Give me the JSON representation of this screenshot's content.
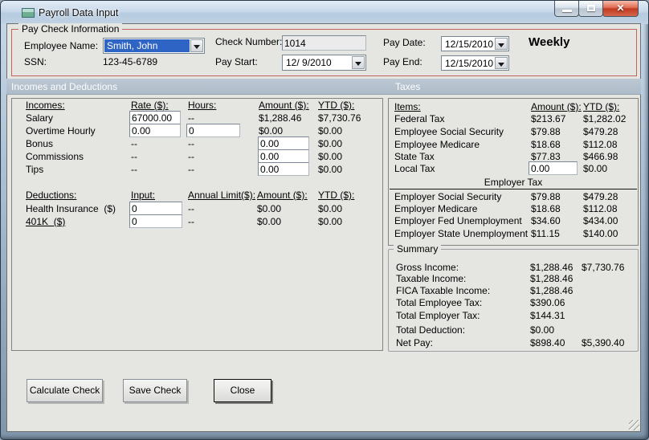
{
  "window": {
    "title": "Payroll Data Input",
    "close_glyph": "✕"
  },
  "paycheck": {
    "legend": "Pay Check Information",
    "employee_name_label": "Employee Name:",
    "employee_name_value": "Smith, John",
    "ssn_label": "SSN:",
    "ssn_value": "123-45-6789",
    "check_number_label": "Check Number:",
    "check_number_value": "1014",
    "pay_start_label": "Pay Start:",
    "pay_start_value": "12/ 9/2010",
    "pay_date_label": "Pay Date:",
    "pay_date_value": "12/15/2010",
    "pay_end_label": "Pay End:",
    "pay_end_value": "12/15/2010",
    "frequency": "Weekly"
  },
  "sections": {
    "left": "Incomes and Deductions",
    "right": "Taxes"
  },
  "incomes": {
    "headers": {
      "name": "Incomes:",
      "rate": "Rate ($):",
      "hours": "Hours:",
      "amount": "Amount ($):",
      "ytd": "YTD ($):"
    },
    "rows": [
      {
        "name": "Salary",
        "rate": "67000.00",
        "hours": "--",
        "amount": "$1,288.46",
        "ytd": "$7,730.76"
      },
      {
        "name": "Overtime Hourly",
        "rate": "0.00",
        "hours": "0",
        "amount": "$0.00",
        "ytd": "$0.00"
      },
      {
        "name": "Bonus",
        "rate": "--",
        "hours": "--",
        "amount": "0.00",
        "ytd": "$0.00"
      },
      {
        "name": "Commissions",
        "rate": "--",
        "hours": "--",
        "amount": "0.00",
        "ytd": "$0.00"
      },
      {
        "name": "Tips",
        "rate": "--",
        "hours": "--",
        "amount": "0.00",
        "ytd": "$0.00"
      }
    ]
  },
  "deductions": {
    "headers": {
      "name": "Deductions:",
      "input": "Input:",
      "annual_limit": "Annual Limit($):",
      "amount": "Amount ($):",
      "ytd": "YTD ($):"
    },
    "rows": [
      {
        "name": "Health Insurance  ($)",
        "input": "0",
        "annual_limit": "--",
        "amount": "$0.00",
        "ytd": "$0.00"
      },
      {
        "name": "401K  ($)",
        "input": "0",
        "annual_limit": "--",
        "amount": "$0.00",
        "ytd": "$0.00"
      }
    ]
  },
  "taxes": {
    "headers": {
      "items": "Items:",
      "amount": "Amount ($):",
      "ytd": "YTD ($):"
    },
    "employee_rows": [
      {
        "name": "Federal Tax",
        "amount": "$213.67",
        "ytd": "$1,282.02"
      },
      {
        "name": "Employee Social Security",
        "amount": "$79.88",
        "ytd": "$479.28"
      },
      {
        "name": "Employee Medicare",
        "amount": "$18.68",
        "ytd": "$112.08"
      },
      {
        "name": "State Tax",
        "amount": "$77.83",
        "ytd": "$466.98"
      }
    ],
    "local_tax": {
      "name": "Local Tax",
      "amount": "0.00",
      "ytd": "$0.00"
    },
    "employer_header": "Employer Tax",
    "employer_rows": [
      {
        "name": "Employer Social Security",
        "amount": "$79.88",
        "ytd": "$479.28"
      },
      {
        "name": "Employer Medicare",
        "amount": "$18.68",
        "ytd": "$112.08"
      },
      {
        "name": "Employer Fed Unemployment",
        "amount": "$34.60",
        "ytd": "$434.00"
      },
      {
        "name": "Employer State Unemployment",
        "amount": "$11.15",
        "ytd": "$140.00"
      }
    ]
  },
  "summary": {
    "legend": "Summary",
    "rows": [
      {
        "name": "Gross Income:",
        "amount": "$1,288.46",
        "ytd": "$7,730.76"
      },
      {
        "name": "Taxable Income:",
        "amount": "$1,288.46",
        "ytd": ""
      },
      {
        "name": "FICA Taxable Income:",
        "amount": "$1,288.46",
        "ytd": ""
      },
      {
        "name": "Total Employee Tax:",
        "amount": "$390.06",
        "ytd": ""
      },
      {
        "name": "Total Employer Tax:",
        "amount": "$144.31",
        "ytd": ""
      },
      {
        "name": "Total Deduction:",
        "amount": "$0.00",
        "ytd": ""
      },
      {
        "name": "Net Pay:",
        "amount": "$898.40",
        "ytd": "$5,390.40"
      }
    ]
  },
  "actions": {
    "calculate": "Calculate Check",
    "save": "Save Check",
    "close": "Close"
  },
  "colors": {
    "titlebar": "#c8d8ea",
    "section_header": "#b4c1ce",
    "paycheck_border": "#c4645a",
    "selection_blue": "#2e65c4",
    "close_button_red": "#c03a20",
    "client_bg": "#e5e5e2"
  }
}
